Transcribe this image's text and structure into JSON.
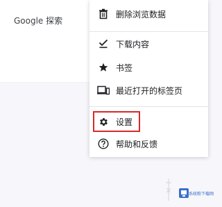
{
  "search": {
    "label": "Google 探索"
  },
  "menu": {
    "items": [
      {
        "label": "删除浏览数据",
        "icon": "trash-icon"
      },
      {
        "label": "下载内容",
        "icon": "download-check-icon"
      },
      {
        "label": "书签",
        "icon": "star-icon"
      },
      {
        "label": "最近打开的标签页",
        "icon": "recent-tabs-icon"
      },
      {
        "label": "设置",
        "icon": "gear-icon"
      },
      {
        "label": "帮助和反馈",
        "icon": "help-icon"
      }
    ]
  },
  "highlight": {
    "color": "#d62a2a"
  },
  "watermark": {
    "text": "系统粉下载网"
  }
}
